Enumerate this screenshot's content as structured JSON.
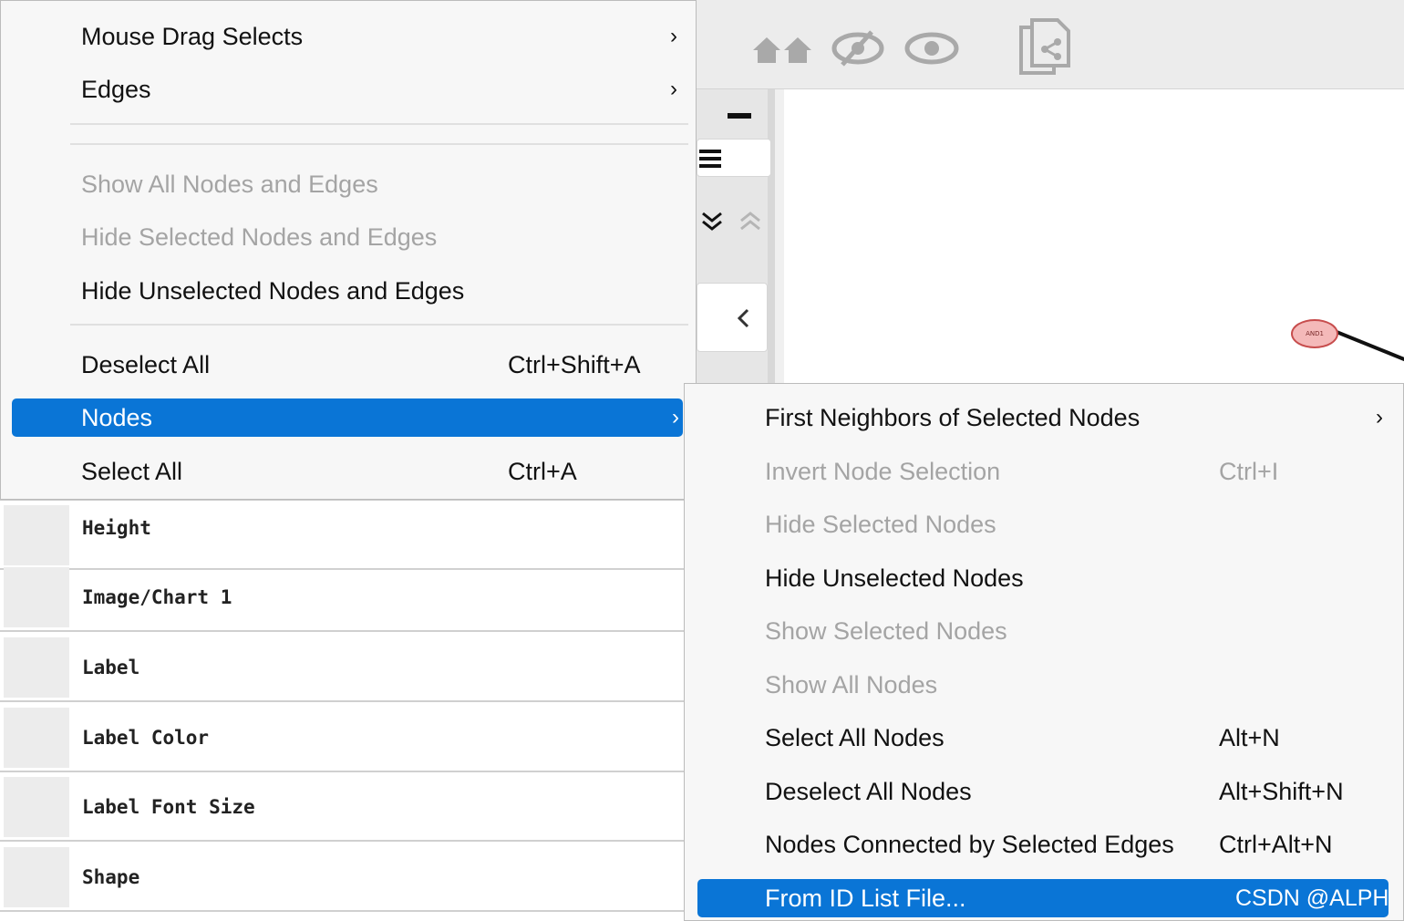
{
  "main_menu": {
    "items": [
      {
        "label": "Mouse Drag Selects",
        "shortcut": "",
        "submenu": true
      },
      {
        "label": "Edges",
        "shortcut": "",
        "submenu": true
      },
      {
        "label": "Show All Nodes and Edges",
        "shortcut": "",
        "disabled": true
      },
      {
        "label": "Hide Selected Nodes and Edges",
        "shortcut": "",
        "disabled": true
      },
      {
        "label": "Hide Unselected Nodes and Edges",
        "shortcut": ""
      },
      {
        "label": "Deselect All",
        "shortcut": "Ctrl+Shift+A"
      },
      {
        "label": "Nodes",
        "shortcut": "",
        "submenu": true,
        "highlighted": true
      },
      {
        "label": "Select All",
        "shortcut": "Ctrl+A"
      }
    ],
    "arrow_glyph": "›"
  },
  "properties": {
    "rows": [
      "Height",
      "Image/Chart 1",
      "Label",
      "Label Color",
      "Label Font Size",
      "Shape"
    ]
  },
  "nodes_submenu": {
    "items": [
      {
        "label": "First Neighbors of Selected Nodes",
        "shortcut": "",
        "submenu": true
      },
      {
        "label": "Invert Node Selection",
        "shortcut": "Ctrl+I",
        "disabled": true
      },
      {
        "label": "Hide Selected Nodes",
        "shortcut": "",
        "disabled": true
      },
      {
        "label": "Hide Unselected Nodes",
        "shortcut": ""
      },
      {
        "label": "Show Selected Nodes",
        "shortcut": "",
        "disabled": true
      },
      {
        "label": "Show All Nodes",
        "shortcut": "",
        "disabled": true
      },
      {
        "label": "Select All Nodes",
        "shortcut": "Alt+N"
      },
      {
        "label": "Deselect All Nodes",
        "shortcut": "Alt+Shift+N"
      },
      {
        "label": "Nodes Connected by Selected Edges",
        "shortcut": "Ctrl+Alt+N"
      },
      {
        "label": "From ID List File...",
        "shortcut": "",
        "highlighted": true
      }
    ]
  },
  "canvas": {
    "node_label": "AND1"
  },
  "watermark": "CSDN @ALPH",
  "colors": {
    "highlight": "#0a75d6",
    "menu_bg": "#f7f7f7",
    "disabled_text": "#a4a4a4",
    "node_fill": "#f4b9b9"
  }
}
